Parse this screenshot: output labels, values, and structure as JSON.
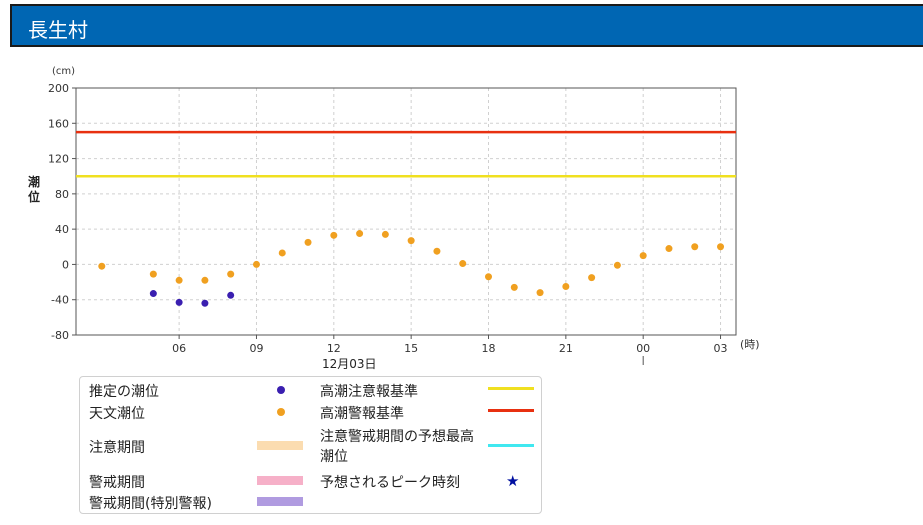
{
  "header": {
    "title": "長生村"
  },
  "colors": {
    "header_bg": "#0066b3",
    "estimated": "#3a1fb0",
    "astronomical": "#f0a020",
    "advisory_line": "#f0e020",
    "warning_line": "#e83010",
    "advisory_period": "#fbdcb0",
    "warning_period": "#f6b0c8",
    "special_warning_period": "#b09be0",
    "forecast_max": "#40e8f0",
    "peak_star": "#0010a0"
  },
  "chart_data": {
    "type": "scatter",
    "ylabel": "潮位",
    "y_unit": "(cm)",
    "x_unit": "(時)",
    "ylim": [
      -80,
      200
    ],
    "yticks": [
      -80,
      -40,
      0,
      40,
      80,
      120,
      160,
      200
    ],
    "xlim": [
      2,
      27.6
    ],
    "xticks": [
      {
        "x": 6,
        "label": "06"
      },
      {
        "x": 9,
        "label": "09"
      },
      {
        "x": 12,
        "label": "12"
      },
      {
        "x": 15,
        "label": "15"
      },
      {
        "x": 18,
        "label": "18"
      },
      {
        "x": 21,
        "label": "21"
      },
      {
        "x": 24,
        "label": "00"
      },
      {
        "x": 27,
        "label": "03"
      }
    ],
    "date_label": "12月03日",
    "grid": true,
    "hlines": [
      {
        "name": "高潮注意報基準",
        "y": 100,
        "color": "#f0e020"
      },
      {
        "name": "高潮警報基準",
        "y": 150,
        "color": "#e83010"
      }
    ],
    "series": [
      {
        "name": "推定の潮位",
        "color": "#3a1fb0",
        "x": [
          5,
          6,
          7,
          8
        ],
        "y": [
          -33,
          -43,
          -44,
          -35
        ]
      },
      {
        "name": "天文潮位",
        "color": "#f0a020",
        "x": [
          3,
          5,
          6,
          7,
          8,
          9,
          10,
          11,
          12,
          13,
          14,
          15,
          16,
          17,
          18,
          19,
          20,
          21,
          22,
          23,
          24,
          25,
          26,
          27
        ],
        "y": [
          -2,
          -11,
          -18,
          -18,
          -11,
          0,
          13,
          25,
          33,
          35,
          34,
          27,
          15,
          1,
          -14,
          -26,
          -32,
          -25,
          -15,
          -1,
          10,
          18,
          20,
          20
        ]
      }
    ]
  },
  "legend": {
    "estimated": "推定の潮位",
    "astronomical": "天文潮位",
    "advisory_period": "注意期間",
    "warning_period": "警戒期間",
    "special_warning_period": "警戒期間(特別警報)",
    "advisory_criteria": "高潮注意報基準",
    "warning_criteria": "高潮警報基準",
    "forecast_max": "注意警戒期間の予想最高潮位",
    "peak_time": "予想されるピーク時刻",
    "peak_symbol": "★"
  }
}
